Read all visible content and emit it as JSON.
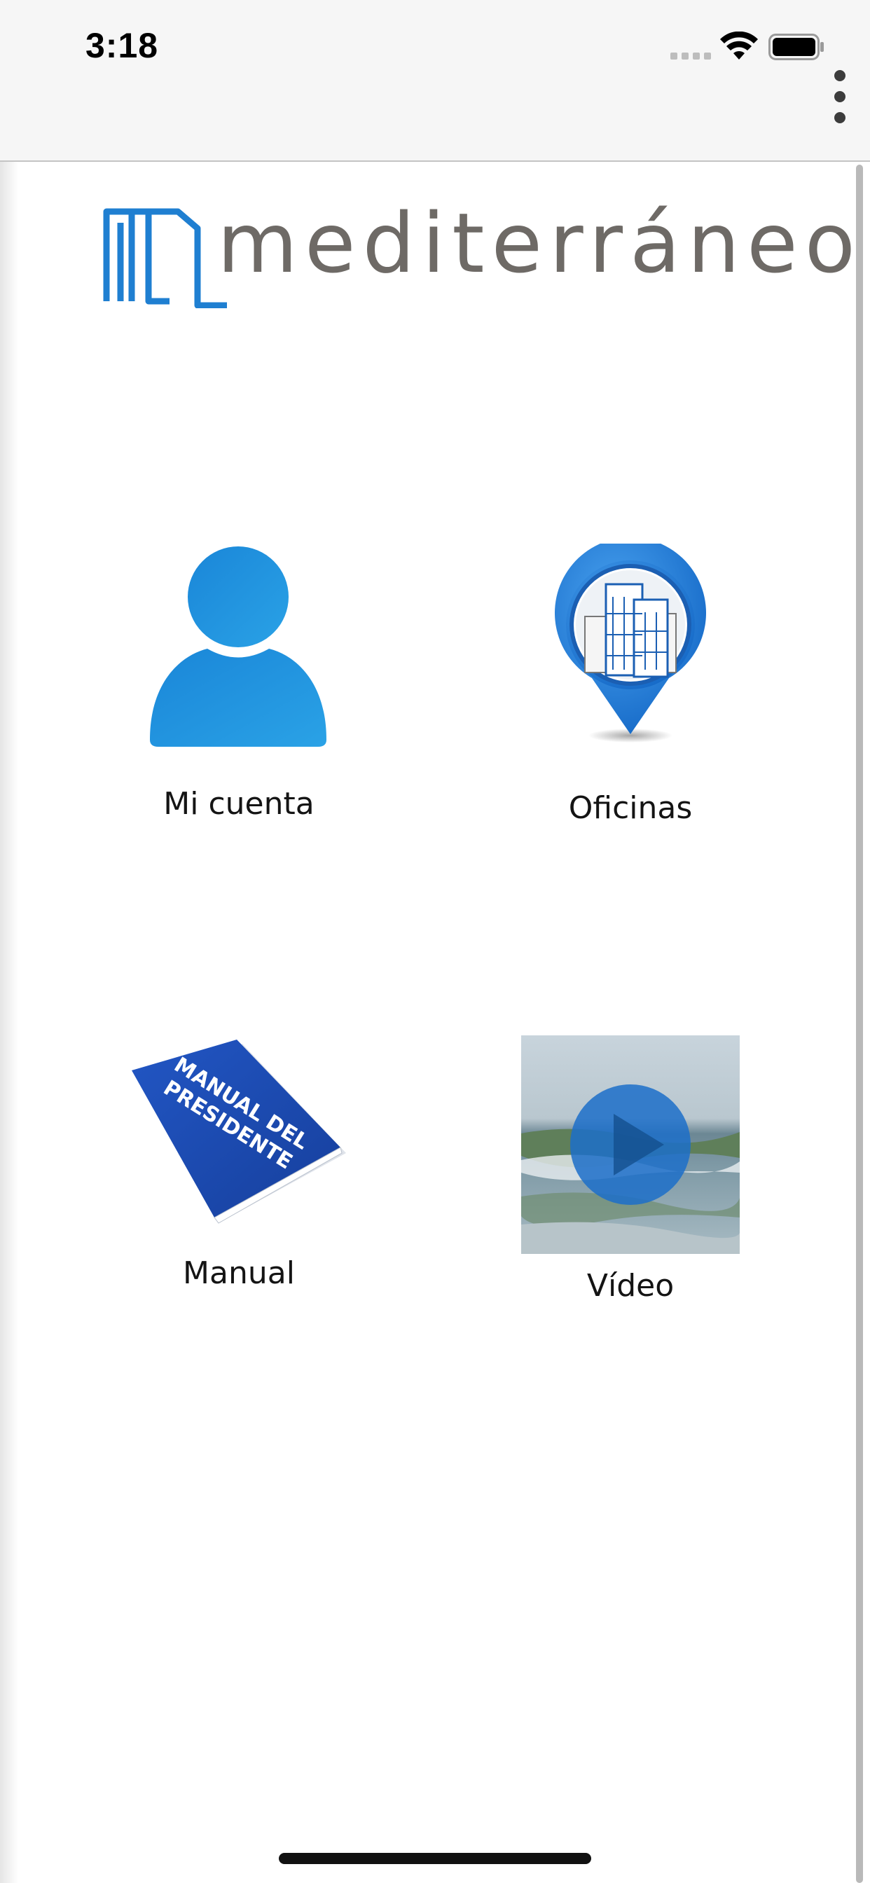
{
  "status_bar": {
    "time": "3:18"
  },
  "header": {
    "menu_icon": "more-vertical-icon"
  },
  "logo": {
    "text": "mediterráneo",
    "icon": "building-outline-icon",
    "brand_color": "#1f7fd1",
    "text_color": "#6e6a66"
  },
  "tiles": [
    {
      "label": "Mi cuenta",
      "icon": "user-icon"
    },
    {
      "label": "Oficinas",
      "icon": "map-pin-building-icon"
    },
    {
      "label": "Manual",
      "icon": "manual-book-icon",
      "cover_text": [
        "MANUAL DEL",
        "PRESIDENTE"
      ]
    },
    {
      "label": "Vídeo",
      "icon": "video-play-icon"
    }
  ],
  "colors": {
    "header_bg": "#f6f6f6",
    "accent_blue": "#1f7fd1"
  }
}
